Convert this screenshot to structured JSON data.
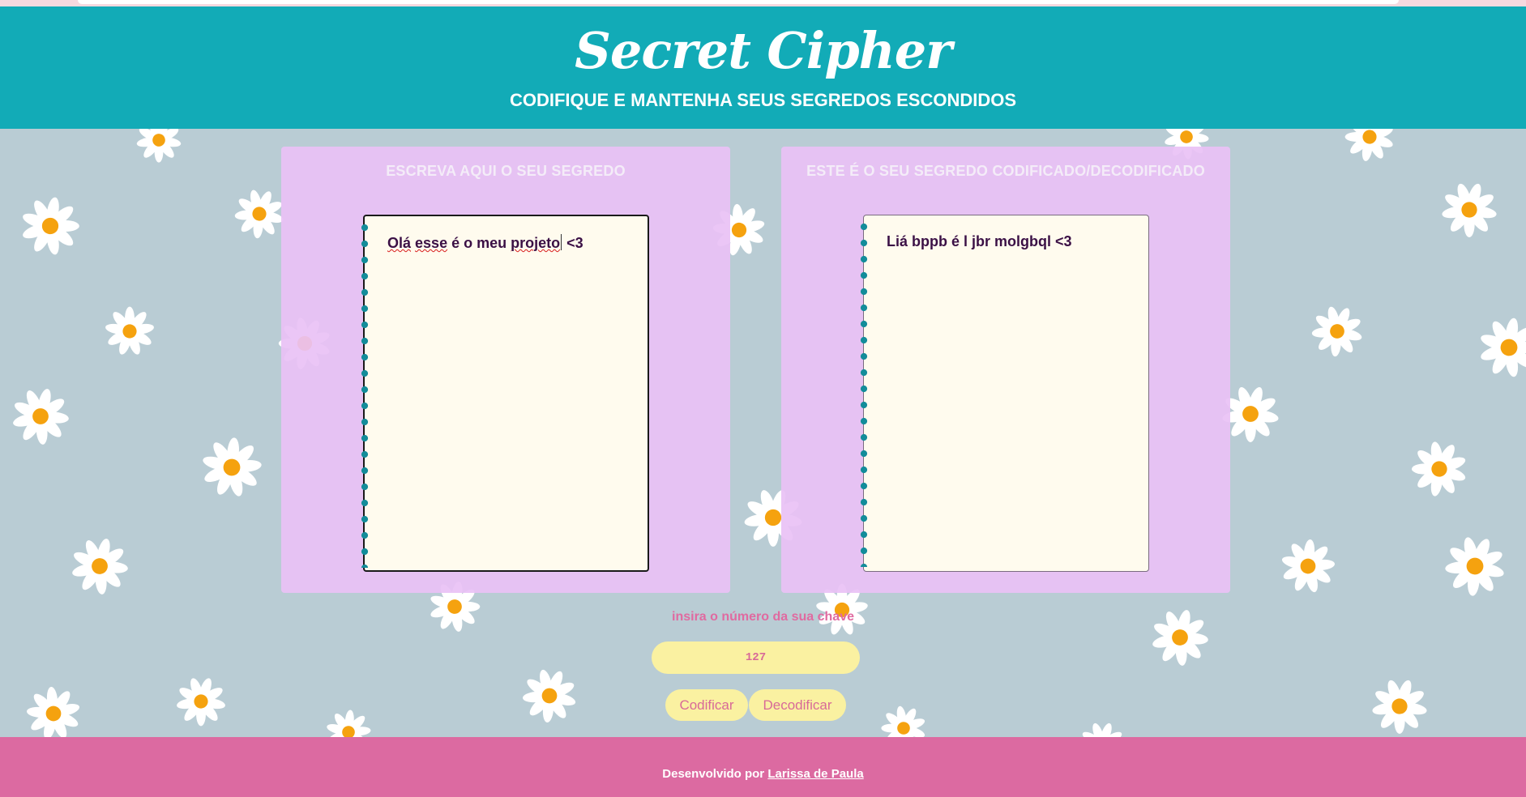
{
  "app": {
    "title": "Secret Cipher",
    "subtitle": "CODIFIQUE E MANTENHA SEUS SEGREDOS ESCONDIDOS"
  },
  "input_panel": {
    "title": "ESCREVA AQUI O SEU SEGREDO",
    "text_part1": "Olá",
    "text_part2": "esse",
    "text_part3": " é o meu ",
    "text_part4": "projeto",
    "text_part5": " <3"
  },
  "output_panel": {
    "title": "ESTE É O SEU SEGREDO CODIFICADO/DECODIFICADO",
    "text": "Liá bppb é l jbr molgbql <3"
  },
  "key": {
    "label": "insira o número da sua chave",
    "value": "127"
  },
  "buttons": {
    "encode": "Codificar",
    "decode": "Decodificar"
  },
  "footer": {
    "prefix": "Desenvolvido por ",
    "author": "Larissa de Paula"
  },
  "colors": {
    "header": "#12abb7",
    "footer": "#dc6aa1",
    "panel": "#e9c1f5",
    "background": "#b9ccd4",
    "button": "#faf1a1",
    "button_text": "#d86a98",
    "spiral": "#138c9a"
  }
}
